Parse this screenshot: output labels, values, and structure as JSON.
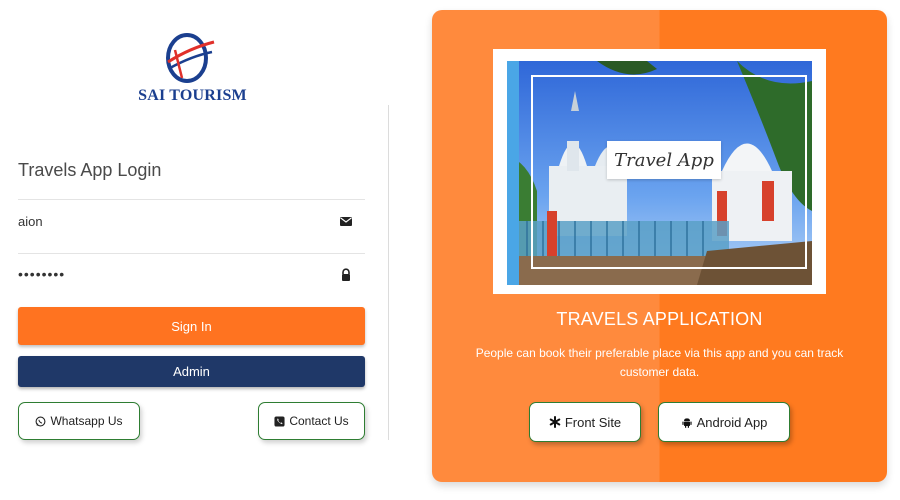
{
  "brand": {
    "logo_text": "SAI TOURISM",
    "colors": {
      "logo_blue": "#1b3f8f",
      "logo_red": "#e0302a"
    }
  },
  "login": {
    "title": "Travels App Login",
    "username_value": "aion",
    "password_value": "••••••••",
    "username_icon": "envelope-icon",
    "password_icon": "lock-icon"
  },
  "buttons": {
    "signin_label": "Sign In",
    "admin_label": "Admin",
    "whatsapp_label": "Whatsapp Us",
    "contact_label": "Contact Us"
  },
  "panel": {
    "image_caption": "Travel App",
    "heading": "TRAVELS APPLICATION",
    "description": "People can book their preferable place via this app and you can track customer data.",
    "front_site_label": "Front Site",
    "android_app_label": "Android App"
  },
  "colors": {
    "accent_orange": "#ff7320",
    "admin_navy": "#1f3868",
    "panel_orange_light": "#ff8a3d",
    "panel_orange_dark": "#ff7a1f",
    "outline_green": "#2e7d32"
  }
}
